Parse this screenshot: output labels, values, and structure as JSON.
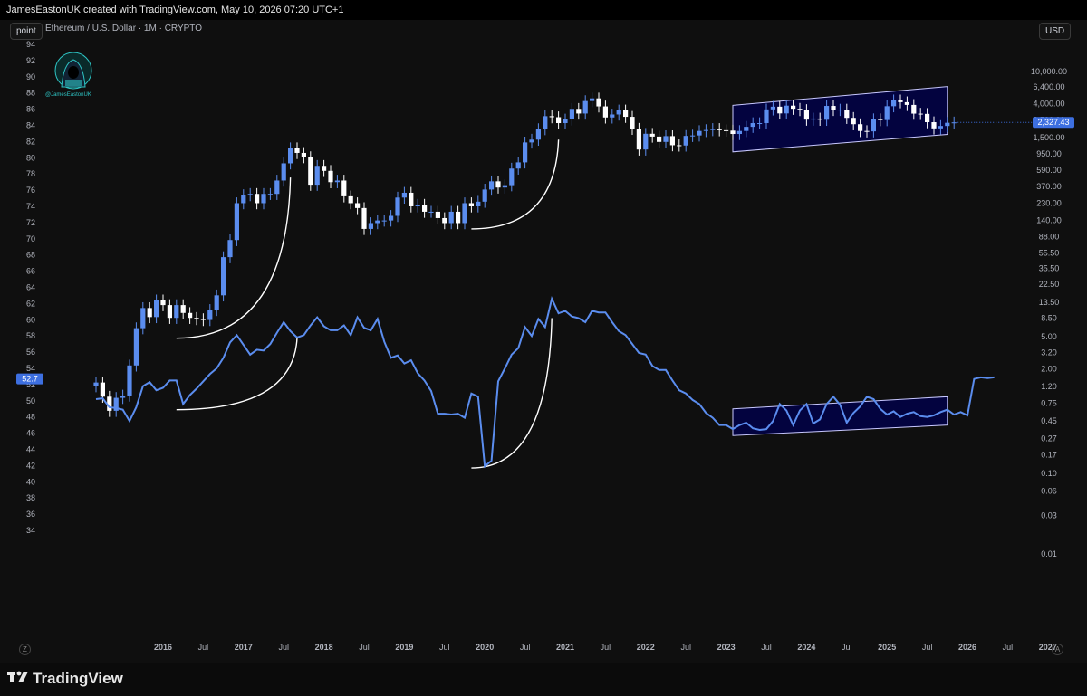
{
  "header": {
    "credit": "JamesEastonUK created with TradingView.com, May 10, 2026 07:20 UTC+1"
  },
  "toolbar": {
    "left_scale": "point",
    "currency": "USD",
    "symbol": "Ethereum / U.S. Dollar · 1M · CRYPTO"
  },
  "watermark": {
    "handle": "@JamesEastonUK"
  },
  "footer": {
    "brand": "TradingView",
    "corner_left": "Z",
    "corner_right": "A"
  },
  "colors": {
    "up": "#5b8def",
    "down": "#ffffff",
    "rsi_line": "#5b8def",
    "channel_fill": "#03033f",
    "curve": "#ffffff",
    "price_tag": "#3d6fe0",
    "bg": "#0f0f0f"
  },
  "chart_data": {
    "type": "candlestick",
    "title": "Ethereum / U.S. Dollar · 1M · CRYPTO",
    "left_axis": {
      "ticks": [
        "94",
        "92",
        "90",
        "88",
        "86",
        "84",
        "82",
        "80",
        "78",
        "76",
        "74",
        "72",
        "70",
        "68",
        "66",
        "64",
        "62",
        "60",
        "58",
        "56",
        "54",
        "52",
        "50",
        "48",
        "46",
        "44",
        "42",
        "40",
        "38",
        "36",
        "34"
      ],
      "current_label": "52.7"
    },
    "right_axis": {
      "scale": "log",
      "ticks": [
        "10,000.00",
        "6,400.00",
        "4,000.00",
        "2,500.00",
        "1,500.00",
        "950.00",
        "590.00",
        "370.00",
        "230.00",
        "140.00",
        "88.00",
        "55.50",
        "35.50",
        "22.50",
        "13.50",
        "8.50",
        "5.00",
        "3.20",
        "2.00",
        "1.20",
        "0.75",
        "0.45",
        "0.27",
        "0.17",
        "0.10",
        "0.06",
        "0.03",
        "0.01"
      ],
      "last_price": "2,327.43"
    },
    "x_axis": {
      "ticks": [
        "2016",
        "Jul",
        "2017",
        "Jul",
        "2018",
        "Jul",
        "2019",
        "Jul",
        "2020",
        "Jul",
        "2021",
        "Jul",
        "2022",
        "Jul",
        "2023",
        "Jul",
        "2024",
        "Jul",
        "2025",
        "Jul",
        "2026",
        "Jul",
        "2027"
      ]
    },
    "price_series": {
      "name": "ETHUSD monthly close",
      "start": "2015-08",
      "closes": [
        1.35,
        0.9,
        0.6,
        0.87,
        0.93,
        2.2,
        6.4,
        11.4,
        8.8,
        14.2,
        12.4,
        8.6,
        12.4,
        9.9,
        8.6,
        8.3,
        8.1,
        10.8,
        16.4,
        49.0,
        80.0,
        230.0,
        290.0,
        300.0,
        230.0,
        300.0,
        300.0,
        440.0,
        720.0,
        1110.0,
        970.0,
        860.0,
        390.0,
        670.0,
        580.0,
        420.0,
        440.0,
        280.0,
        230.0,
        200.0,
        110.0,
        130.0,
        140.0,
        140.0,
        160.0,
        270.0,
        310.0,
        210.0,
        220.0,
        180.0,
        180.0,
        150.0,
        130.0,
        180.0,
        130.0,
        230.0,
        210.0,
        240.0,
        340.0,
        430.0,
        360.0,
        385.0,
        620.0,
        740.0,
        1310.0,
        1420.0,
        1920.0,
        2780.0,
        2700.0,
        2280.0,
        2530.0,
        3430.0,
        3000.0,
        4290.0,
        4630.0,
        3680.0,
        2680.0,
        2920.0,
        3280.0,
        2730.0,
        1940.0,
        1070.0,
        1680.0,
        1550.0,
        1330.0,
        1570.0,
        1210.0,
        1200.0,
        1580.0,
        1600.0,
        1820.0,
        1870.0,
        1930.0,
        1860.0,
        1840.0,
        1670.0,
        1820.0,
        2050.0,
        2280.0,
        2280.0,
        3380.0,
        3650.0,
        3010.0,
        3760.0,
        3440.0,
        3320.0,
        2520.0,
        2600.0,
        2510.0,
        3730.0,
        3330.0,
        3360.0,
        2650.0,
        2210.0,
        1820.0,
        1800.0,
        2550.0,
        2490.0,
        3700.0,
        4380.0,
        4150.0,
        3840.0,
        2990.0,
        2970.0,
        2340.0,
        1960.0,
        2100.0,
        2300.0,
        2327.43
      ]
    },
    "rsi_series": {
      "name": "monthly RSI",
      "values": [
        50.2,
        50.3,
        49.2,
        49.1,
        48.9,
        47.5,
        49.2,
        51.8,
        52.3,
        51.3,
        51.6,
        52.5,
        52.5,
        49.6,
        50.7,
        51.5,
        52.4,
        53.3,
        54.0,
        55.3,
        57.2,
        58.1,
        56.9,
        55.7,
        56.3,
        56.2,
        57.0,
        58.4,
        59.7,
        58.6,
        57.8,
        58.1,
        59.3,
        60.3,
        59.2,
        58.7,
        58.7,
        59.3,
        58.1,
        60.3,
        59.0,
        58.7,
        60.1,
        57.3,
        55.3,
        55.6,
        54.6,
        55.0,
        53.4,
        52.5,
        51.2,
        48.4,
        48.4,
        48.3,
        48.4,
        47.9,
        50.9,
        50.5,
        41.9,
        42.6,
        52.4,
        54.0,
        55.7,
        56.5,
        59.1,
        58.0,
        60.1,
        59.1,
        62.6,
        60.8,
        61.1,
        60.4,
        60.2,
        59.7,
        61.1,
        60.9,
        60.9,
        59.7,
        58.6,
        58.1,
        57.0,
        55.9,
        55.7,
        54.3,
        53.8,
        53.8,
        52.5,
        51.3,
        50.9,
        50.1,
        49.6,
        48.5,
        47.9,
        47.0,
        47.0,
        46.5,
        47.0,
        47.3,
        46.6,
        46.4,
        46.5,
        47.5,
        49.6,
        48.8,
        47.0,
        48.8,
        49.6,
        47.2,
        47.7,
        49.6,
        50.5,
        49.5,
        47.3,
        48.5,
        49.3,
        50.5,
        50.2,
        49.0,
        48.3,
        48.7,
        48.0,
        48.4,
        48.6,
        48.1,
        48.0,
        48.2,
        48.6,
        48.9,
        48.3,
        48.6,
        48.2,
        52.7,
        52.9,
        52.8,
        52.9
      ]
    },
    "annotations": [
      "ascending channel on price 2023–2026",
      "ascending channel on RSI 2023–2026",
      "parabolic curves marking prior advances"
    ]
  }
}
